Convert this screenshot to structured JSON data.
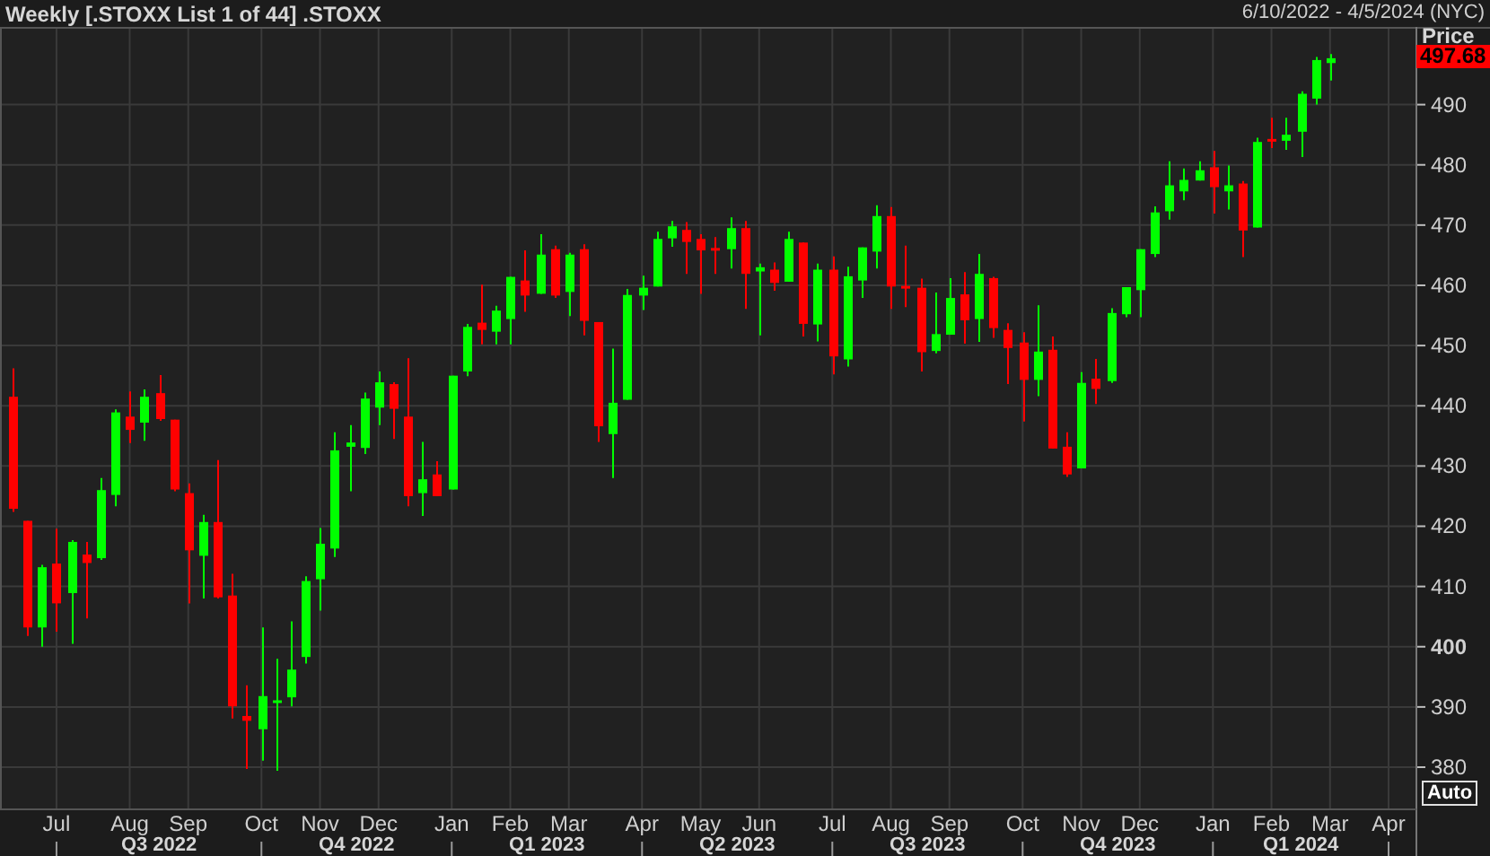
{
  "header": {
    "title": "Weekly [.STOXX List 1 of 44] .STOXX",
    "date_range": "6/10/2022 - 4/5/2024 (NYC)"
  },
  "price_axis": {
    "title": "Price",
    "last_price": "497.68",
    "scale_button": "Auto"
  },
  "quarters": [
    "Q3 2022",
    "Q4 2022",
    "Q1 2023",
    "Q2 2023",
    "Q3 2023",
    "Q4 2023",
    "Q1 2024"
  ],
  "chart_data": {
    "type": "candlestick",
    "grid": true,
    "categories": [
      null,
      null,
      null,
      "Jul",
      null,
      null,
      null,
      null,
      "Aug",
      null,
      null,
      null,
      "Sep",
      null,
      null,
      null,
      null,
      "Oct",
      null,
      null,
      null,
      "Nov",
      null,
      null,
      null,
      "Dec",
      null,
      null,
      null,
      null,
      "Jan",
      null,
      null,
      null,
      "Feb",
      null,
      null,
      null,
      "Mar",
      null,
      null,
      null,
      null,
      "Apr",
      null,
      null,
      null,
      "May",
      null,
      null,
      null,
      "Jun",
      null,
      null,
      null,
      null,
      "Jul",
      null,
      null,
      null,
      "Aug",
      null,
      null,
      null,
      "Sep",
      null,
      null,
      null,
      null,
      "Oct",
      null,
      null,
      null,
      "Nov",
      null,
      null,
      null,
      "Dec",
      null,
      null,
      null,
      null,
      "Jan",
      null,
      null,
      null,
      "Feb",
      null,
      null,
      null,
      "Mar",
      null,
      null,
      null,
      "Apr",
      null
    ],
    "ylim": [
      373,
      502.9
    ],
    "yticks": [
      380,
      390,
      400,
      410,
      420,
      430,
      440,
      450,
      460,
      470,
      480,
      490
    ],
    "ohlc": [
      [
        441.5,
        446.2,
        422.4,
        422.9
      ],
      [
        420.9,
        420.9,
        401.8,
        403.2
      ],
      [
        403.2,
        413.6,
        400.0,
        413.2
      ],
      [
        413.8,
        419.6,
        402.5,
        407.2
      ],
      [
        408.9,
        417.7,
        400.5,
        417.4
      ],
      [
        415.3,
        417.4,
        404.7,
        413.9
      ],
      [
        414.7,
        428.0,
        414.4,
        426.0
      ],
      [
        425.2,
        439.4,
        423.3,
        438.9
      ],
      [
        438.2,
        442.4,
        433.8,
        436.0
      ],
      [
        437.2,
        442.7,
        434.2,
        441.5
      ],
      [
        442.1,
        445.1,
        437.5,
        437.8
      ],
      [
        437.7,
        437.7,
        425.8,
        426.1
      ],
      [
        425.5,
        427.1,
        407.2,
        416.0
      ],
      [
        415.1,
        421.9,
        408.0,
        420.7
      ],
      [
        420.7,
        431.0,
        408.0,
        408.2
      ],
      [
        408.5,
        412.1,
        388.1,
        390.1
      ],
      [
        388.5,
        393.6,
        379.7,
        387.7
      ],
      [
        386.3,
        403.2,
        381.1,
        391.8
      ],
      [
        390.9,
        398.0,
        379.4,
        391.1
      ],
      [
        391.6,
        404.2,
        390.1,
        396.2
      ],
      [
        398.3,
        411.7,
        397.2,
        410.9
      ],
      [
        411.2,
        419.7,
        406.0,
        417.1
      ],
      [
        416.3,
        435.6,
        414.9,
        432.6
      ],
      [
        433.2,
        436.8,
        425.8,
        433.9
      ],
      [
        433.0,
        442.2,
        432.0,
        441.2
      ],
      [
        439.7,
        445.7,
        436.8,
        443.9
      ],
      [
        443.6,
        443.9,
        434.5,
        439.5
      ],
      [
        438.2,
        447.9,
        423.3,
        425.0
      ],
      [
        425.5,
        434.0,
        421.7,
        427.8
      ],
      [
        428.6,
        430.8,
        425.0,
        425.0
      ],
      [
        426.1,
        445.0,
        426.1,
        445.0
      ],
      [
        445.7,
        453.6,
        444.9,
        453.1
      ],
      [
        453.8,
        460.1,
        450.2,
        452.6
      ],
      [
        452.3,
        456.6,
        450.2,
        455.8
      ],
      [
        454.4,
        461.4,
        450.2,
        461.4
      ],
      [
        460.8,
        465.8,
        455.6,
        458.3
      ],
      [
        458.6,
        468.5,
        458.6,
        465.1
      ],
      [
        466.0,
        466.6,
        457.9,
        458.3
      ],
      [
        458.9,
        465.4,
        454.9,
        465.1
      ],
      [
        466.0,
        466.8,
        451.7,
        454.1
      ],
      [
        453.9,
        453.9,
        434.0,
        436.6
      ],
      [
        435.3,
        449.5,
        428.0,
        440.5
      ],
      [
        441.0,
        459.4,
        441.0,
        458.4
      ],
      [
        458.3,
        461.6,
        455.9,
        459.6
      ],
      [
        459.8,
        468.9,
        459.8,
        467.7
      ],
      [
        467.8,
        470.7,
        466.4,
        469.8
      ],
      [
        469.2,
        470.5,
        461.9,
        467.2
      ],
      [
        467.7,
        468.5,
        458.6,
        465.8
      ],
      [
        466.2,
        468.0,
        461.9,
        466.0
      ],
      [
        466.0,
        471.3,
        462.8,
        469.5
      ],
      [
        469.5,
        470.7,
        456.1,
        461.9
      ],
      [
        462.3,
        463.6,
        451.7,
        463.0
      ],
      [
        462.6,
        463.8,
        459.1,
        460.4
      ],
      [
        460.6,
        468.9,
        460.6,
        467.7
      ],
      [
        467.1,
        467.1,
        451.5,
        453.6
      ],
      [
        453.5,
        463.6,
        450.7,
        462.6
      ],
      [
        462.6,
        464.8,
        445.2,
        448.2
      ],
      [
        447.7,
        463.1,
        446.5,
        461.5
      ],
      [
        460.8,
        466.3,
        457.9,
        466.3
      ],
      [
        465.6,
        473.3,
        462.8,
        471.5
      ],
      [
        471.5,
        473.0,
        456.1,
        459.8
      ],
      [
        459.9,
        466.6,
        456.4,
        459.8
      ],
      [
        459.6,
        461.1,
        445.7,
        448.9
      ],
      [
        449.1,
        458.8,
        448.7,
        451.9
      ],
      [
        451.8,
        461.2,
        451.8,
        457.9
      ],
      [
        458.5,
        462.2,
        450.3,
        454.2
      ],
      [
        454.4,
        465.2,
        450.6,
        461.9
      ],
      [
        461.2,
        461.4,
        451.3,
        452.9
      ],
      [
        452.6,
        453.7,
        443.6,
        449.6
      ],
      [
        450.5,
        452.2,
        437.4,
        444.3
      ],
      [
        444.3,
        456.7,
        441.6,
        449.0
      ],
      [
        449.3,
        451.5,
        432.9,
        432.9
      ],
      [
        433.2,
        435.6,
        428.2,
        428.6
      ],
      [
        429.6,
        445.6,
        429.6,
        443.8
      ],
      [
        444.5,
        447.8,
        440.3,
        442.8
      ],
      [
        444.1,
        456.2,
        443.8,
        455.4
      ],
      [
        455.2,
        459.7,
        454.7,
        459.7
      ],
      [
        459.2,
        466.0,
        454.7,
        466.0
      ],
      [
        465.2,
        473.1,
        464.7,
        472.1
      ],
      [
        472.3,
        480.6,
        470.9,
        476.6
      ],
      [
        475.6,
        479.4,
        474.1,
        477.5
      ],
      [
        477.4,
        480.6,
        477.4,
        479.1
      ],
      [
        479.6,
        482.3,
        471.9,
        476.3
      ],
      [
        475.6,
        479.9,
        472.6,
        476.6
      ],
      [
        476.9,
        477.3,
        464.7,
        469.1
      ],
      [
        469.6,
        484.5,
        469.6,
        483.8
      ],
      [
        484.3,
        487.8,
        482.8,
        484.0
      ],
      [
        484.0,
        487.8,
        482.5,
        485.0
      ],
      [
        485.5,
        492.2,
        481.3,
        491.8
      ],
      [
        491.0,
        497.9,
        490.0,
        497.4
      ],
      [
        496.9,
        498.4,
        494.0,
        497.7
      ],
      null,
      null,
      null,
      null,
      null
    ]
  }
}
